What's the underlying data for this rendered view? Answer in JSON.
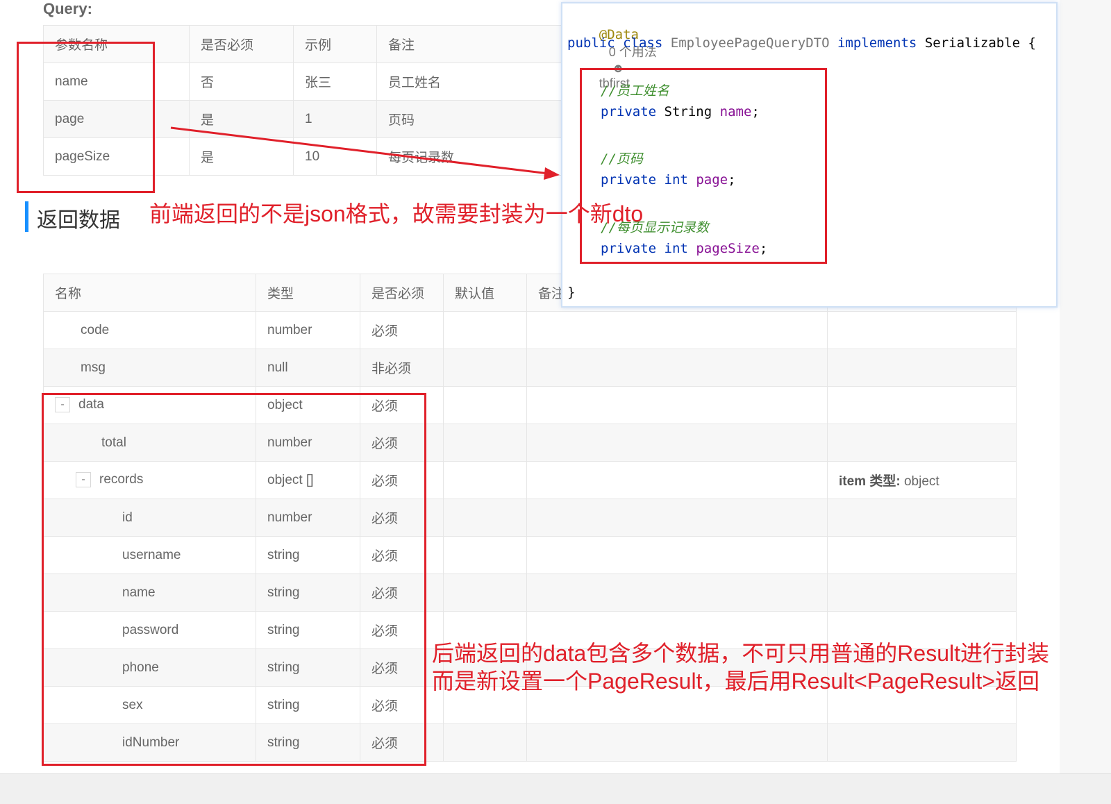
{
  "query": {
    "title": "Query:",
    "headers": [
      "参数名称",
      "是否必须",
      "示例",
      "备注"
    ],
    "rows": [
      {
        "name": "name",
        "required": "否",
        "example": "张三",
        "note": "员工姓名"
      },
      {
        "name": "page",
        "required": "是",
        "example": "1",
        "note": "页码"
      },
      {
        "name": "pageSize",
        "required": "是",
        "example": "10",
        "note": "每页记录数"
      }
    ]
  },
  "section": {
    "title": "返回数据"
  },
  "result": {
    "headers": [
      "名称",
      "类型",
      "是否必须",
      "默认值",
      "备注",
      ""
    ],
    "rows": [
      {
        "name": "code",
        "type": "number",
        "required": "必须",
        "desc": ""
      },
      {
        "name": "msg",
        "type": "null",
        "required": "非必须",
        "desc": ""
      },
      {
        "name": "data",
        "type": "object",
        "required": "必须",
        "desc": "",
        "toggle": "-"
      },
      {
        "name": "total",
        "type": "number",
        "required": "必须",
        "desc": ""
      },
      {
        "name": "records",
        "type": "object []",
        "required": "必须",
        "desc_bold": "item 类型:",
        "desc": " object",
        "toggle": "-"
      },
      {
        "name": "id",
        "type": "number",
        "required": "必须",
        "desc": ""
      },
      {
        "name": "username",
        "type": "string",
        "required": "必须",
        "desc": ""
      },
      {
        "name": "name",
        "type": "string",
        "required": "必须",
        "desc": ""
      },
      {
        "name": "password",
        "type": "string",
        "required": "必须",
        "desc": ""
      },
      {
        "name": "phone",
        "type": "string",
        "required": "必须",
        "desc": ""
      },
      {
        "name": "sex",
        "type": "string",
        "required": "必须",
        "desc": ""
      },
      {
        "name": "idNumber",
        "type": "string",
        "required": "必须",
        "desc": ""
      }
    ]
  },
  "code": {
    "annotation": "@Data",
    "usages": "0 个用法",
    "author": "tbfirst",
    "kw_public": "public",
    "kw_class": "class",
    "class_name": "EmployeePageQueryDTO",
    "kw_implements": "implements",
    "iface": "Serializable {",
    "c1": "//员工姓名",
    "l1_kw": "private",
    "l1_type": "String",
    "l1_field": "name",
    "c2": "//页码",
    "l2_kw": "private",
    "l2_type": "int",
    "l2_field": "page",
    "c3": "//每页显示记录数",
    "l3_kw": "private",
    "l3_type": "int",
    "l3_field": "pageSize",
    "semi": ";",
    "close": "}"
  },
  "annotations": {
    "note1": "前端返回的不是json格式，故需要封装为一个新dto",
    "note2_line1": "后端返回的data包含多个数据，不可只用普通的Result进行封装",
    "note2_line2": "而是新设置一个PageResult，最后用Result<PageResult>返回"
  },
  "colors": {
    "annotation_red": "#e0202a",
    "section_accent": "#1890ff",
    "keyword": "#0033b3",
    "field": "#871094",
    "comment": "#3f8f2f"
  }
}
